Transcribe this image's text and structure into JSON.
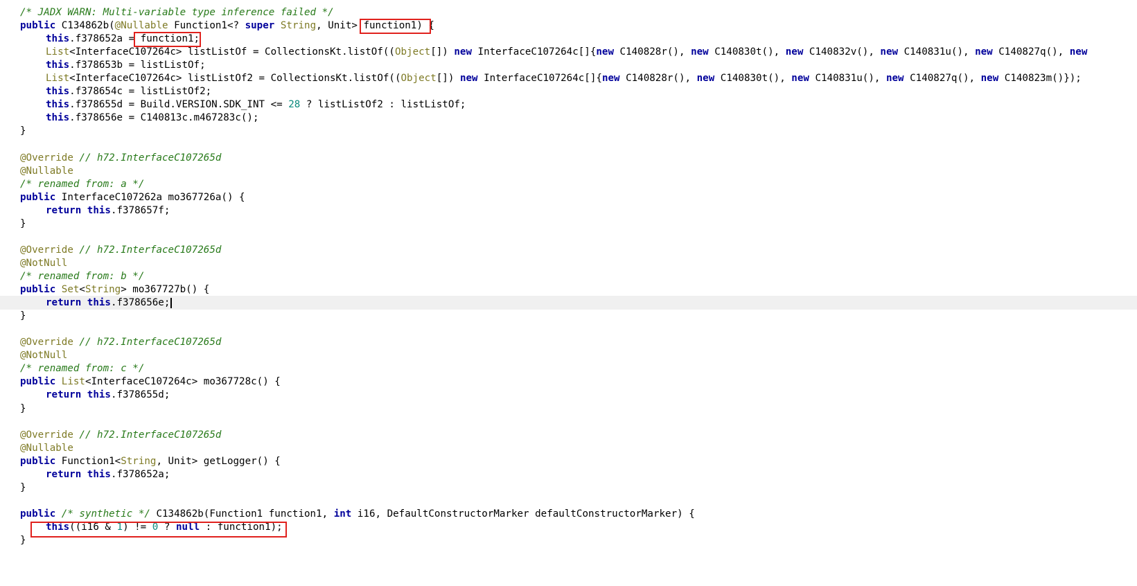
{
  "editor": {
    "current_line": 23,
    "lines": [
      [
        {
          "t": "/* JADX WARN: Multi-variable type inference failed */",
          "c": "comment"
        }
      ],
      [
        {
          "t": "public",
          "c": "kw"
        },
        {
          "t": " C134862b(",
          "c": "plain"
        },
        {
          "t": "@Nullable",
          "c": "anno"
        },
        {
          "t": " Function1<? ",
          "c": "plain"
        },
        {
          "t": "super",
          "c": "kw"
        },
        {
          "t": " ",
          "c": "plain"
        },
        {
          "t": "String",
          "c": "type"
        },
        {
          "t": ", Unit> function1) {",
          "c": "plain"
        }
      ],
      [
        {
          "t": "    ",
          "c": "indent"
        },
        {
          "t": "this",
          "c": "kw"
        },
        {
          "t": ".f378652a = function1;",
          "c": "plain"
        }
      ],
      [
        {
          "t": "    ",
          "c": "indent"
        },
        {
          "t": "List",
          "c": "type"
        },
        {
          "t": "<InterfaceC107264c> listListOf = CollectionsKt.listOf((",
          "c": "plain"
        },
        {
          "t": "Object",
          "c": "type"
        },
        {
          "t": "[]) ",
          "c": "plain"
        },
        {
          "t": "new",
          "c": "kw"
        },
        {
          "t": " InterfaceC107264c[]{",
          "c": "plain"
        },
        {
          "t": "new",
          "c": "kw"
        },
        {
          "t": " C140828r(), ",
          "c": "plain"
        },
        {
          "t": "new",
          "c": "kw"
        },
        {
          "t": " C140830t(), ",
          "c": "plain"
        },
        {
          "t": "new",
          "c": "kw"
        },
        {
          "t": " C140832v(), ",
          "c": "plain"
        },
        {
          "t": "new",
          "c": "kw"
        },
        {
          "t": " C140831u(), ",
          "c": "plain"
        },
        {
          "t": "new",
          "c": "kw"
        },
        {
          "t": " C140827q(), ",
          "c": "plain"
        },
        {
          "t": "new",
          "c": "kw"
        }
      ],
      [
        {
          "t": "    ",
          "c": "indent"
        },
        {
          "t": "this",
          "c": "kw"
        },
        {
          "t": ".f378653b = listListOf;",
          "c": "plain"
        }
      ],
      [
        {
          "t": "    ",
          "c": "indent"
        },
        {
          "t": "List",
          "c": "type"
        },
        {
          "t": "<InterfaceC107264c> listListOf2 = CollectionsKt.listOf((",
          "c": "plain"
        },
        {
          "t": "Object",
          "c": "type"
        },
        {
          "t": "[]) ",
          "c": "plain"
        },
        {
          "t": "new",
          "c": "kw"
        },
        {
          "t": " InterfaceC107264c[]{",
          "c": "plain"
        },
        {
          "t": "new",
          "c": "kw"
        },
        {
          "t": " C140828r(), ",
          "c": "plain"
        },
        {
          "t": "new",
          "c": "kw"
        },
        {
          "t": " C140830t(), ",
          "c": "plain"
        },
        {
          "t": "new",
          "c": "kw"
        },
        {
          "t": " C140831u(), ",
          "c": "plain"
        },
        {
          "t": "new",
          "c": "kw"
        },
        {
          "t": " C140827q(), ",
          "c": "plain"
        },
        {
          "t": "new",
          "c": "kw"
        },
        {
          "t": " C140823m()});",
          "c": "plain"
        }
      ],
      [
        {
          "t": "    ",
          "c": "indent"
        },
        {
          "t": "this",
          "c": "kw"
        },
        {
          "t": ".f378654c = listListOf2;",
          "c": "plain"
        }
      ],
      [
        {
          "t": "    ",
          "c": "indent"
        },
        {
          "t": "this",
          "c": "kw"
        },
        {
          "t": ".f378655d = Build.VERSION.SDK_INT <= ",
          "c": "plain"
        },
        {
          "t": "28",
          "c": "num"
        },
        {
          "t": " ? listListOf2 : listListOf;",
          "c": "plain"
        }
      ],
      [
        {
          "t": "    ",
          "c": "indent"
        },
        {
          "t": "this",
          "c": "kw"
        },
        {
          "t": ".f378656e = C140813c.m467283c();",
          "c": "plain"
        }
      ],
      [
        {
          "t": "}",
          "c": "plain"
        }
      ],
      [],
      [
        {
          "t": "@Override",
          "c": "anno"
        },
        {
          "t": " // h72.InterfaceC107265d",
          "c": "comment"
        }
      ],
      [
        {
          "t": "@Nullable",
          "c": "anno"
        }
      ],
      [
        {
          "t": "/* renamed from: a */",
          "c": "comment"
        }
      ],
      [
        {
          "t": "public",
          "c": "kw"
        },
        {
          "t": " InterfaceC107262a mo367726a() {",
          "c": "plain"
        }
      ],
      [
        {
          "t": "    ",
          "c": "indent"
        },
        {
          "t": "return",
          "c": "kw"
        },
        {
          "t": " ",
          "c": "plain"
        },
        {
          "t": "this",
          "c": "kw"
        },
        {
          "t": ".f378657f;",
          "c": "plain"
        }
      ],
      [
        {
          "t": "}",
          "c": "plain"
        }
      ],
      [],
      [
        {
          "t": "@Override",
          "c": "anno"
        },
        {
          "t": " // h72.InterfaceC107265d",
          "c": "comment"
        }
      ],
      [
        {
          "t": "@NotNull",
          "c": "anno"
        }
      ],
      [
        {
          "t": "/* renamed from: b */",
          "c": "comment"
        }
      ],
      [
        {
          "t": "public",
          "c": "kw"
        },
        {
          "t": " ",
          "c": "plain"
        },
        {
          "t": "Set",
          "c": "type"
        },
        {
          "t": "<",
          "c": "plain"
        },
        {
          "t": "String",
          "c": "type"
        },
        {
          "t": "> mo367727b() {",
          "c": "plain"
        }
      ],
      [
        {
          "t": "    ",
          "c": "indent"
        },
        {
          "t": "return",
          "c": "kw"
        },
        {
          "t": " ",
          "c": "plain"
        },
        {
          "t": "this",
          "c": "kw"
        },
        {
          "t": ".f378656e;",
          "c": "plain"
        },
        {
          "t": "",
          "c": "caret"
        }
      ],
      [
        {
          "t": "}",
          "c": "plain"
        }
      ],
      [],
      [
        {
          "t": "@Override",
          "c": "anno"
        },
        {
          "t": " // h72.InterfaceC107265d",
          "c": "comment"
        }
      ],
      [
        {
          "t": "@NotNull",
          "c": "anno"
        }
      ],
      [
        {
          "t": "/* renamed from: c */",
          "c": "comment"
        }
      ],
      [
        {
          "t": "public",
          "c": "kw"
        },
        {
          "t": " ",
          "c": "plain"
        },
        {
          "t": "List",
          "c": "type"
        },
        {
          "t": "<InterfaceC107264c> mo367728c() {",
          "c": "plain"
        }
      ],
      [
        {
          "t": "    ",
          "c": "indent"
        },
        {
          "t": "return",
          "c": "kw"
        },
        {
          "t": " ",
          "c": "plain"
        },
        {
          "t": "this",
          "c": "kw"
        },
        {
          "t": ".f378655d;",
          "c": "plain"
        }
      ],
      [
        {
          "t": "}",
          "c": "plain"
        }
      ],
      [],
      [
        {
          "t": "@Override",
          "c": "anno"
        },
        {
          "t": " // h72.InterfaceC107265d",
          "c": "comment"
        }
      ],
      [
        {
          "t": "@Nullable",
          "c": "anno"
        }
      ],
      [
        {
          "t": "public",
          "c": "kw"
        },
        {
          "t": " Function1<",
          "c": "plain"
        },
        {
          "t": "String",
          "c": "type"
        },
        {
          "t": ", Unit> getLogger() {",
          "c": "plain"
        }
      ],
      [
        {
          "t": "    ",
          "c": "indent"
        },
        {
          "t": "return",
          "c": "kw"
        },
        {
          "t": " ",
          "c": "plain"
        },
        {
          "t": "this",
          "c": "kw"
        },
        {
          "t": ".f378652a;",
          "c": "plain"
        }
      ],
      [
        {
          "t": "}",
          "c": "plain"
        }
      ],
      [],
      [
        {
          "t": "public",
          "c": "kw"
        },
        {
          "t": " ",
          "c": "plain"
        },
        {
          "t": "/* synthetic */",
          "c": "comment"
        },
        {
          "t": " C134862b(Function1 function1, ",
          "c": "plain"
        },
        {
          "t": "int",
          "c": "kw"
        },
        {
          "t": " i16, DefaultConstructorMarker defaultConstructorMarker) {",
          "c": "plain"
        }
      ],
      [
        {
          "t": "    ",
          "c": "indent"
        },
        {
          "t": "this",
          "c": "kw"
        },
        {
          "t": "((i16 & ",
          "c": "plain"
        },
        {
          "t": "1",
          "c": "num"
        },
        {
          "t": ") != ",
          "c": "plain"
        },
        {
          "t": "0",
          "c": "num"
        },
        {
          "t": " ? ",
          "c": "plain"
        },
        {
          "t": "null",
          "c": "kw"
        },
        {
          "t": " : function1);",
          "c": "plain"
        }
      ],
      [
        {
          "t": "}",
          "c": "plain"
        }
      ]
    ]
  }
}
